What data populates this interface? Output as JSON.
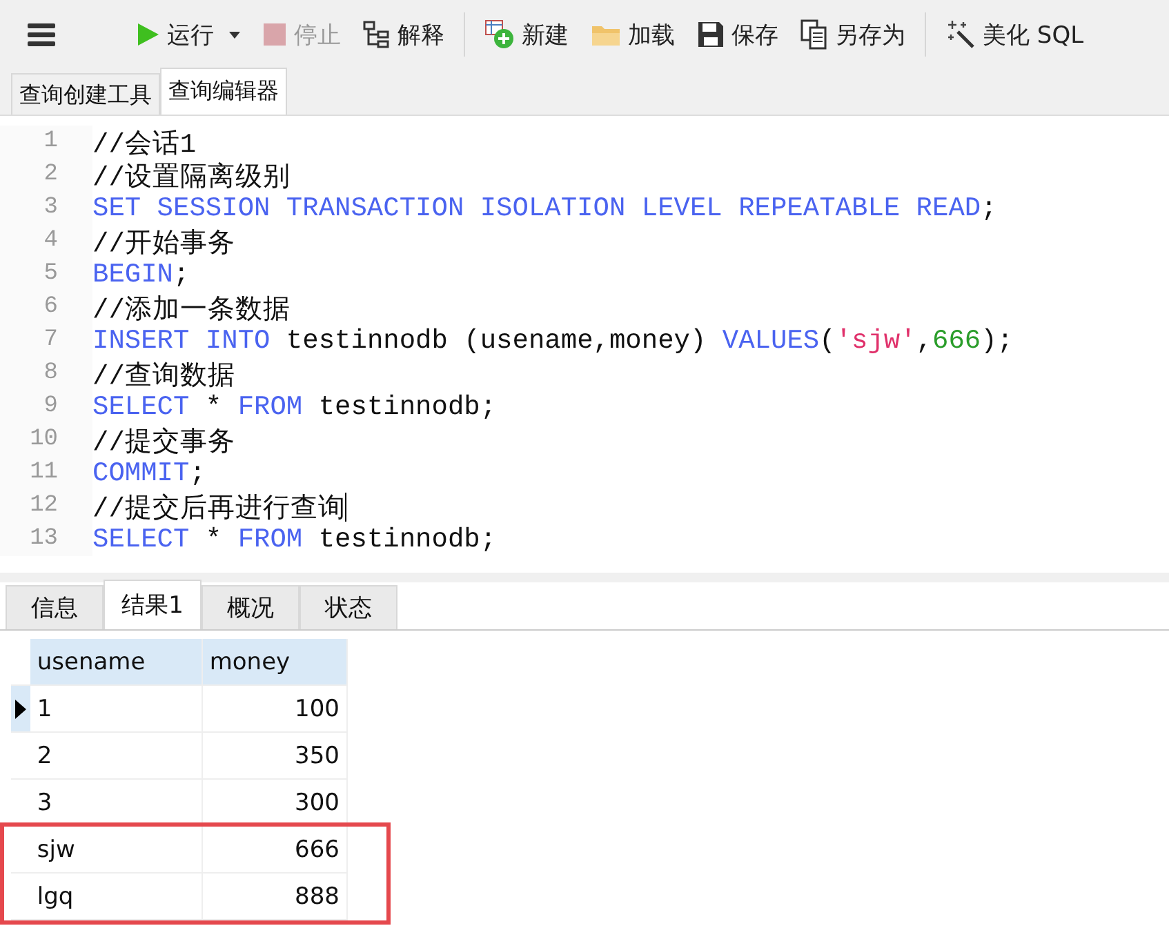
{
  "toolbar": [
    {
      "kind": "menu"
    },
    {
      "kind": "run",
      "label": "运行",
      "disabled": false
    },
    {
      "kind": "stop",
      "label": "停止",
      "disabled": true
    },
    {
      "kind": "explain",
      "label": "解释",
      "disabled": false
    },
    {
      "kind": "new",
      "label": "新建",
      "disabled": false
    },
    {
      "kind": "load",
      "label": "加载",
      "disabled": false
    },
    {
      "kind": "save",
      "label": "保存",
      "disabled": false
    },
    {
      "kind": "saveas",
      "label": "另存为",
      "disabled": false
    },
    {
      "kind": "beautify",
      "label": "美化 SQL",
      "disabled": false
    }
  ],
  "tabs": [
    {
      "label": "查询创建工具",
      "selected": false
    },
    {
      "label": "查询编辑器",
      "selected": true
    }
  ],
  "editor": {
    "lines": [
      {
        "number": "1",
        "caret": false,
        "tokens": [
          {
            "kind": "comment",
            "text": "//会话1"
          }
        ]
      },
      {
        "number": "2",
        "caret": false,
        "tokens": [
          {
            "kind": "comment",
            "text": "//设置隔离级别"
          }
        ]
      },
      {
        "number": "3",
        "caret": false,
        "tokens": [
          {
            "kind": "keyword",
            "text": "SET SESSION TRANSACTION ISOLATION LEVEL REPEATABLE READ"
          },
          {
            "kind": "plain",
            "text": ";"
          }
        ]
      },
      {
        "number": "4",
        "caret": false,
        "tokens": [
          {
            "kind": "comment",
            "text": "//开始事务"
          }
        ]
      },
      {
        "number": "5",
        "caret": false,
        "tokens": [
          {
            "kind": "keyword",
            "text": "BEGIN"
          },
          {
            "kind": "plain",
            "text": ";"
          }
        ]
      },
      {
        "number": "6",
        "caret": false,
        "tokens": [
          {
            "kind": "comment",
            "text": "//添加一条数据"
          }
        ]
      },
      {
        "number": "7",
        "caret": false,
        "tokens": [
          {
            "kind": "keyword",
            "text": "INSERT INTO"
          },
          {
            "kind": "plain",
            "text": " testinnodb (usename,money) "
          },
          {
            "kind": "keyword",
            "text": "VALUES"
          },
          {
            "kind": "plain",
            "text": "("
          },
          {
            "kind": "string",
            "text": "'sjw'"
          },
          {
            "kind": "plain",
            "text": ","
          },
          {
            "kind": "number",
            "text": "666"
          },
          {
            "kind": "plain",
            "text": ");"
          }
        ]
      },
      {
        "number": "8",
        "caret": false,
        "tokens": [
          {
            "kind": "comment",
            "text": "//查询数据"
          }
        ]
      },
      {
        "number": "9",
        "caret": false,
        "tokens": [
          {
            "kind": "keyword",
            "text": "SELECT"
          },
          {
            "kind": "plain",
            "text": " * "
          },
          {
            "kind": "keyword",
            "text": "FROM"
          },
          {
            "kind": "plain",
            "text": " testinnodb;"
          }
        ]
      },
      {
        "number": "10",
        "caret": false,
        "tokens": [
          {
            "kind": "comment",
            "text": "//提交事务"
          }
        ]
      },
      {
        "number": "11",
        "caret": false,
        "tokens": [
          {
            "kind": "keyword",
            "text": "COMMIT"
          },
          {
            "kind": "plain",
            "text": ";"
          }
        ]
      },
      {
        "number": "12",
        "caret": true,
        "tokens": [
          {
            "kind": "comment",
            "text": "//提交后再进行查询"
          }
        ]
      },
      {
        "number": "13",
        "caret": false,
        "tokens": [
          {
            "kind": "keyword",
            "text": "SELECT"
          },
          {
            "kind": "plain",
            "text": " * "
          },
          {
            "kind": "keyword",
            "text": "FROM"
          },
          {
            "kind": "plain",
            "text": " testinnodb;"
          }
        ]
      }
    ]
  },
  "result_tabs": [
    {
      "label": "信息",
      "selected": false
    },
    {
      "label": "结果1",
      "selected": true
    },
    {
      "label": "概况",
      "selected": false
    },
    {
      "label": "状态",
      "selected": false
    }
  ],
  "table": {
    "columns": [
      "usename",
      "money"
    ],
    "rows": [
      {
        "cells": [
          "1",
          "100"
        ],
        "current": true,
        "highlighted": false
      },
      {
        "cells": [
          "2",
          "350"
        ],
        "current": false,
        "highlighted": false
      },
      {
        "cells": [
          "3",
          "300"
        ],
        "current": false,
        "highlighted": false
      },
      {
        "cells": [
          "sjw",
          "666"
        ],
        "current": false,
        "highlighted": true
      },
      {
        "cells": [
          "lgq",
          "888"
        ],
        "current": false,
        "highlighted": true
      }
    ]
  }
}
